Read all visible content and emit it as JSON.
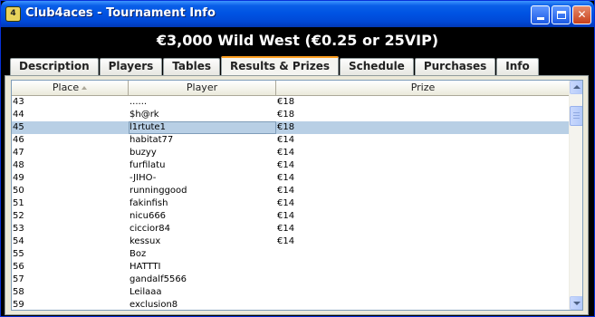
{
  "window": {
    "app_icon_text": "4",
    "title": "Club4aces - Tournament Info"
  },
  "heading": "€3,000 Wild West (€0.25 or 25VIP)",
  "tabs": [
    {
      "label": "Description",
      "active": false
    },
    {
      "label": "Players",
      "active": false
    },
    {
      "label": "Tables",
      "active": false
    },
    {
      "label": "Results & Prizes",
      "active": true
    },
    {
      "label": "Schedule",
      "active": false
    },
    {
      "label": "Purchases",
      "active": false
    },
    {
      "label": "Info",
      "active": false
    }
  ],
  "table": {
    "columns": [
      "Place",
      "Player",
      "Prize"
    ],
    "sorted_column": "Place",
    "selected_place": "45",
    "rows": [
      {
        "place": "43",
        "player": "......",
        "prize": "€18"
      },
      {
        "place": "44",
        "player": "$h@rk",
        "prize": "€18"
      },
      {
        "place": "45",
        "player": "l1rtute1",
        "prize": "€18"
      },
      {
        "place": "46",
        "player": "habitat77",
        "prize": "€14"
      },
      {
        "place": "47",
        "player": "buzyy",
        "prize": "€14"
      },
      {
        "place": "48",
        "player": "furfilatu",
        "prize": "€14"
      },
      {
        "place": "49",
        "player": "-JIHO-",
        "prize": "€14"
      },
      {
        "place": "50",
        "player": "runninggood",
        "prize": "€14"
      },
      {
        "place": "51",
        "player": "fakinfish",
        "prize": "€14"
      },
      {
        "place": "52",
        "player": "nicu666",
        "prize": "€14"
      },
      {
        "place": "53",
        "player": "ciccior84",
        "prize": "€14"
      },
      {
        "place": "54",
        "player": "kessux",
        "prize": "€14"
      },
      {
        "place": "55",
        "player": "Boz",
        "prize": ""
      },
      {
        "place": "56",
        "player": "HATTTI",
        "prize": ""
      },
      {
        "place": "57",
        "player": "gandalf5566",
        "prize": ""
      },
      {
        "place": "58",
        "player": "Leilaaa",
        "prize": ""
      },
      {
        "place": "59",
        "player": "exclusion8",
        "prize": ""
      }
    ]
  },
  "colors": {
    "titlebar": "#0054e3",
    "selected_row": "#b8cfe5",
    "active_tab_accent": "#ff9e1f"
  }
}
